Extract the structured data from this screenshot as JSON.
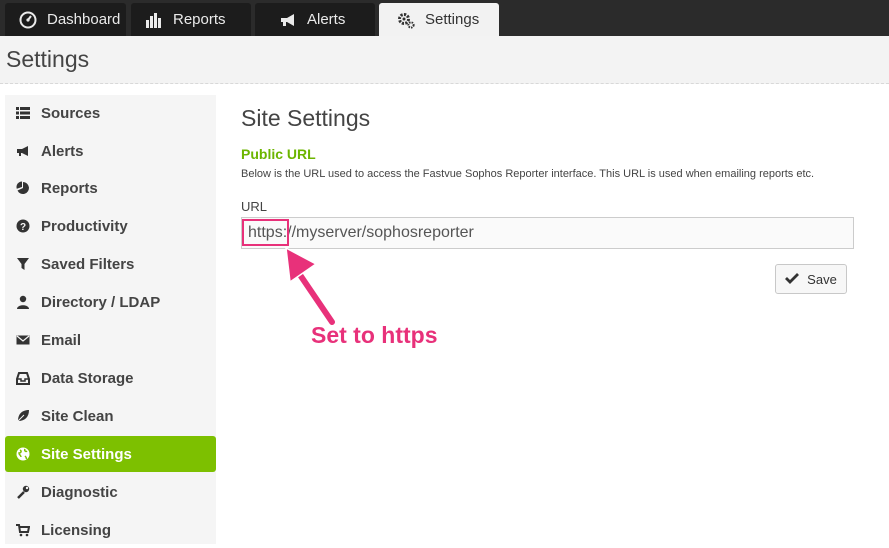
{
  "nav": {
    "tabs": [
      {
        "label": "Dashboard",
        "icon": "speedometer-icon"
      },
      {
        "label": "Reports",
        "icon": "bar-chart-icon"
      },
      {
        "label": "Alerts",
        "icon": "megaphone-icon"
      },
      {
        "label": "Settings",
        "icon": "gears-icon",
        "active": true
      }
    ]
  },
  "header": {
    "title": "Settings"
  },
  "sidebar": {
    "items": [
      {
        "label": "Sources",
        "icon": "list-icon"
      },
      {
        "label": "Alerts",
        "icon": "megaphone-icon"
      },
      {
        "label": "Reports",
        "icon": "pie-chart-icon"
      },
      {
        "label": "Productivity",
        "icon": "question-icon"
      },
      {
        "label": "Saved Filters",
        "icon": "filter-icon"
      },
      {
        "label": "Directory / LDAP",
        "icon": "user-icon"
      },
      {
        "label": "Email",
        "icon": "envelope-icon"
      },
      {
        "label": "Data Storage",
        "icon": "inbox-icon"
      },
      {
        "label": "Site Clean",
        "icon": "leaf-icon"
      },
      {
        "label": "Site Settings",
        "icon": "globe-icon",
        "active": true
      },
      {
        "label": "Diagnostic",
        "icon": "wrench-icon"
      },
      {
        "label": "Licensing",
        "icon": "cart-icon"
      }
    ]
  },
  "main": {
    "title": "Site Settings",
    "section_title": "Public URL",
    "description": "Below is the URL used to access the Fastvue Sophos Reporter interface. This URL is used when emailing reports etc.",
    "url_label": "URL",
    "url_value": "https://myserver/sophosreporter",
    "save_label": "Save"
  },
  "annotation": {
    "text": "Set to https",
    "color": "#e8317a"
  },
  "colors": {
    "accent": "#7dc000",
    "section_title": "#6cb500",
    "annotation": "#e8317a",
    "nav_bg": "#2b2b2b"
  }
}
